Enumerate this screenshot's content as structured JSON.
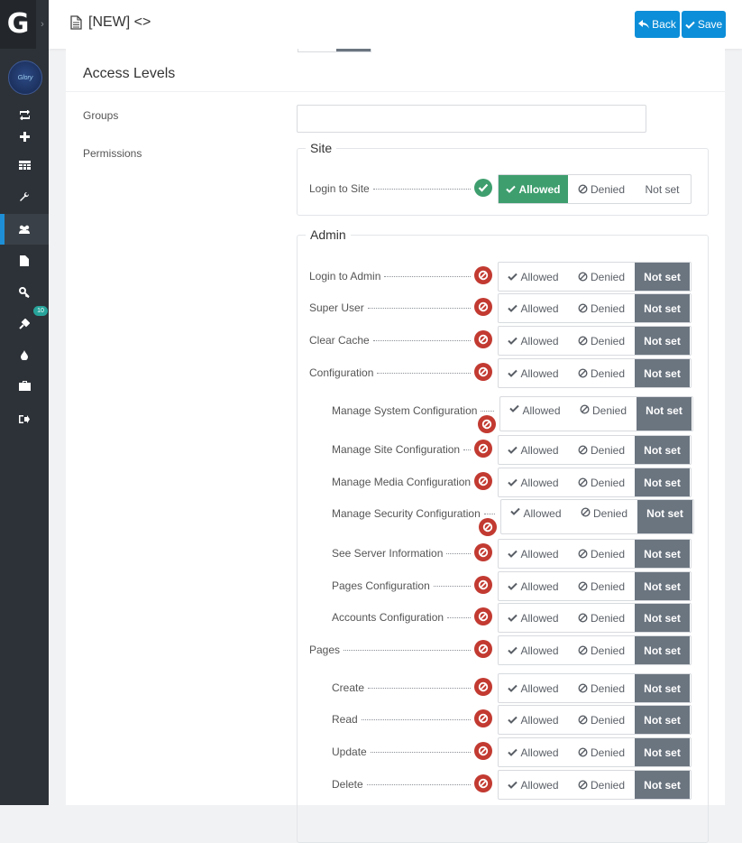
{
  "app": {
    "logo_letter": "G",
    "toggle": "›",
    "avatar_text": "Glory"
  },
  "header": {
    "title": "[NEW] <>",
    "back_label": "Back",
    "save_label": "Save"
  },
  "sidebar": {
    "items": [
      {
        "icon": "retweet-icon"
      },
      {
        "icon": "plus-icon"
      },
      {
        "icon": "table-icon"
      },
      {
        "icon": "wrench-icon"
      },
      {
        "icon": "users-icon",
        "active": true
      },
      {
        "icon": "file-icon"
      },
      {
        "icon": "key-icon"
      },
      {
        "icon": "plug-icon",
        "badge": "10"
      },
      {
        "icon": "tint-icon"
      },
      {
        "icon": "briefcase-icon"
      },
      {
        "icon": "sign-out-icon"
      }
    ]
  },
  "main": {
    "section_title": "Access Levels",
    "groups_label": "Groups",
    "groups_value": "",
    "permissions_label": "Permissions",
    "option_labels": {
      "allowed": "Allowed",
      "denied": "Denied",
      "not_set": "Not set"
    },
    "site": {
      "legend": "Site",
      "rows": [
        {
          "label": "Login to Site",
          "state": "allowed"
        }
      ]
    },
    "admin": {
      "legend": "Admin",
      "rows": [
        {
          "label": "Login to Admin",
          "state": "not_set"
        },
        {
          "label": "Super User",
          "state": "not_set"
        },
        {
          "label": "Clear Cache",
          "state": "not_set"
        },
        {
          "label": "Configuration",
          "state": "not_set"
        },
        {
          "label": "Manage System Configuration",
          "state": "not_set"
        },
        {
          "label": "Manage Site Configuration",
          "state": "not_set"
        },
        {
          "label": "Manage Media Configuration",
          "state": "not_set"
        },
        {
          "label": "Manage Security Configuration",
          "state": "not_set"
        },
        {
          "label": "See Server Information",
          "state": "not_set"
        },
        {
          "label": "Pages Configuration",
          "state": "not_set"
        },
        {
          "label": "Accounts Configuration",
          "state": "not_set"
        },
        {
          "label": "Pages",
          "state": "not_set"
        },
        {
          "label": "Create",
          "state": "not_set"
        },
        {
          "label": "Read",
          "state": "not_set"
        },
        {
          "label": "Update",
          "state": "not_set"
        },
        {
          "label": "Delete",
          "state": "not_set"
        }
      ]
    }
  },
  "colors": {
    "primary": "#0d8ed8",
    "allowed": "#3e9e6e",
    "denied": "#c23a31",
    "not_set": "#6b7580",
    "sidebar": "#2d3238"
  }
}
